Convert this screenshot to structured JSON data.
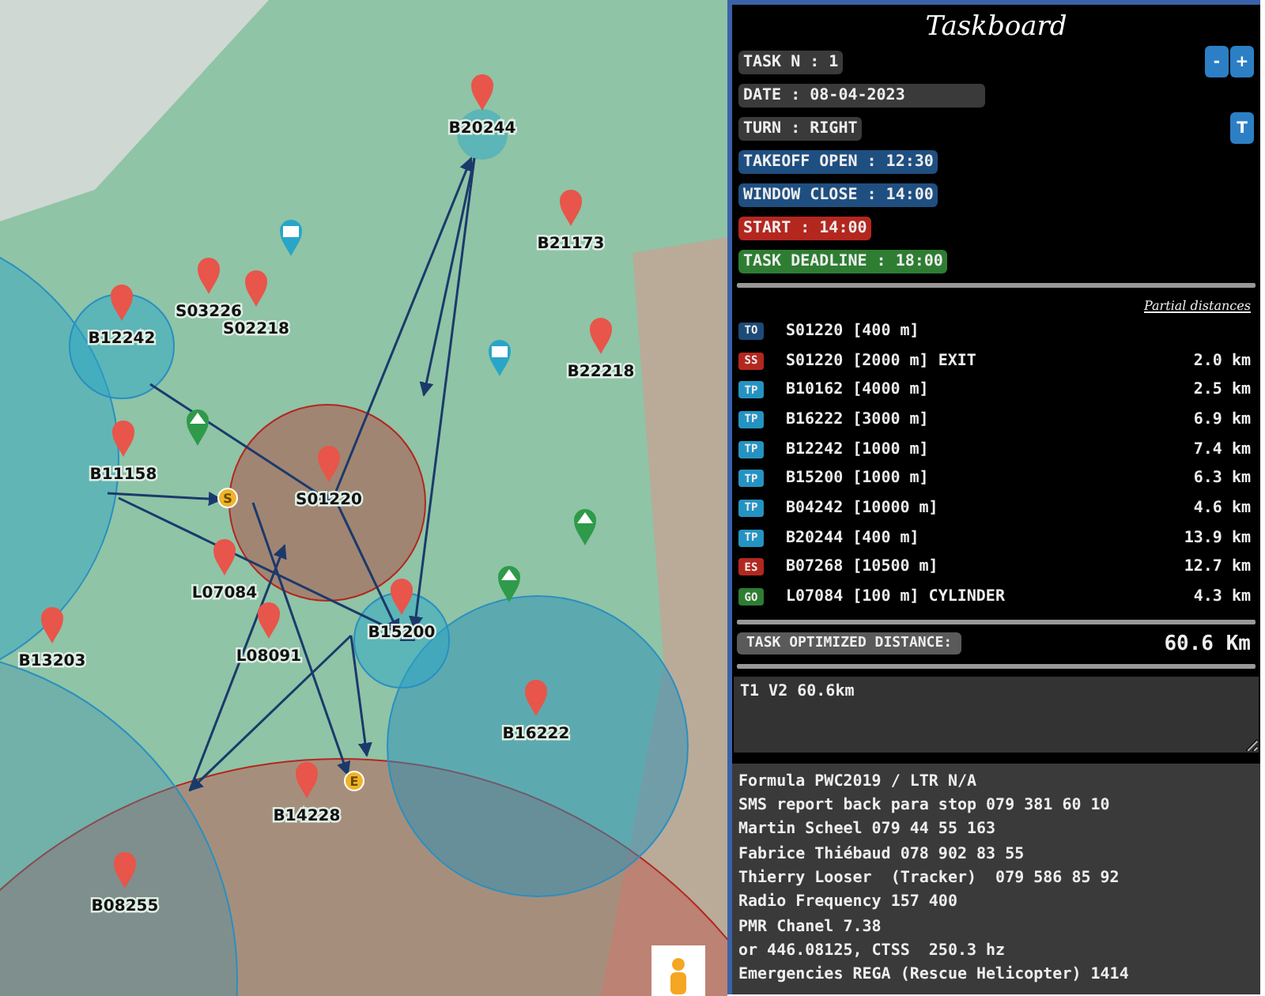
{
  "map": {
    "waypoints": [
      {
        "label": "B20244"
      },
      {
        "label": "B21173"
      },
      {
        "label": "S03226"
      },
      {
        "label": "S02218"
      },
      {
        "label": "B12242"
      },
      {
        "label": "B22218"
      },
      {
        "label": "B11158"
      },
      {
        "label": "S01220"
      },
      {
        "label": "L07084"
      },
      {
        "label": "B15200"
      },
      {
        "label": "B13203"
      },
      {
        "label": "L08091"
      },
      {
        "label": "B16222"
      },
      {
        "label": "B14228"
      },
      {
        "label": "B08255"
      }
    ],
    "markers": [
      {
        "letter": "S"
      },
      {
        "letter": "E"
      }
    ]
  },
  "taskboard": {
    "title": "Taskboard",
    "badges": [
      {
        "text": "TASK N : 1",
        "kind": "grey"
      },
      {
        "text": "DATE : 08-04-2023",
        "kind": "wide"
      },
      {
        "text": "TURN : RIGHT",
        "kind": "grey"
      },
      {
        "text": "TAKEOFF OPEN : 12:30",
        "kind": "blue"
      },
      {
        "text": "WINDOW CLOSE : 14:00",
        "kind": "blue"
      },
      {
        "text": "START : 14:00",
        "kind": "red"
      },
      {
        "text": "TASK DEADLINE : 18:00",
        "kind": "green"
      }
    ],
    "stepper": [
      "-",
      "+"
    ],
    "turn_button": "T",
    "partial_heading": "Partial distances",
    "turnpoints": [
      {
        "type": "TO",
        "name": "S01220 [400 m]"
      },
      {
        "type": "SS",
        "name": "S01220 [2000 m] EXIT",
        "distance": "2.0 km"
      },
      {
        "type": "TP",
        "name": "B10162 [4000 m]",
        "distance": "2.5 km"
      },
      {
        "type": "TP",
        "name": "B16222 [3000 m]",
        "distance": "6.9 km"
      },
      {
        "type": "TP",
        "name": "B12242 [1000 m]",
        "distance": "7.4 km"
      },
      {
        "type": "TP",
        "name": "B15200 [1000 m]",
        "distance": "6.3 km"
      },
      {
        "type": "TP",
        "name": "B04242 [10000 m]",
        "distance": "4.6 km"
      },
      {
        "type": "TP",
        "name": "B20244 [400 m]",
        "distance": "13.9 km"
      },
      {
        "type": "ES",
        "name": "B07268 [10500 m]",
        "distance": "12.7 km"
      },
      {
        "type": "GO",
        "name": "L07084 [100 m] CYLINDER",
        "distance": "4.3 km"
      }
    ],
    "total_label": "TASK OPTIMIZED DISTANCE:",
    "total_value": "60.6 Km",
    "notes": "T1 V2 60.6km",
    "info_lines": [
      "Formula PWC2019 / LTR N/A",
      "SMS report back para stop 079 381 60 10",
      "Martin Scheel 079 44 55 163",
      "Fabrice Thiébaud 078 902 83 55",
      "Thierry Looser  (Tracker)  079 586 85 92",
      "Radio Frequency 157 400",
      "PMR Chanel 7.38",
      "or 446.08125, CTSS  250.3 hz",
      "Emergencies REGA (Rescue Helicopter) 1414"
    ]
  }
}
